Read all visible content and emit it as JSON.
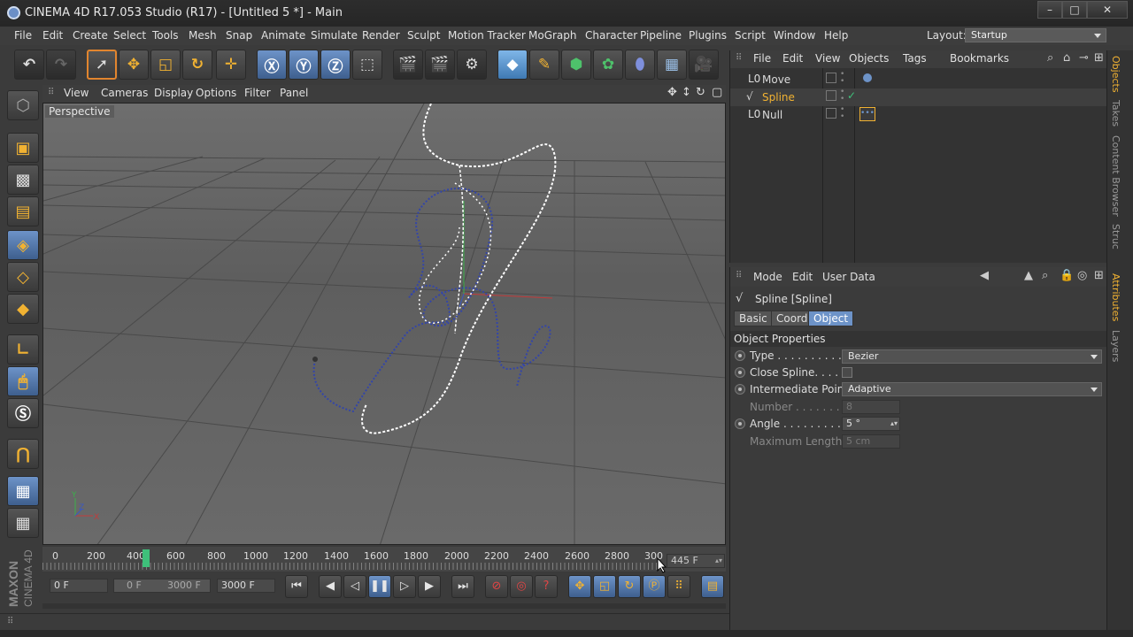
{
  "window": {
    "title": "CINEMA 4D R17.053 Studio (R17) - [Untitled 5 *] - Main",
    "minimize": "–",
    "maximize": "□",
    "close": "✕"
  },
  "menubar": {
    "items": [
      "File",
      "Edit",
      "Create",
      "Select",
      "Tools",
      "Mesh",
      "Snap",
      "Animate",
      "Simulate",
      "Render",
      "Sculpt",
      "Motion Tracker",
      "MoGraph",
      "Character",
      "Pipeline",
      "Plugins",
      "Script",
      "Window",
      "Help"
    ],
    "layout_label": "Layout:",
    "layout_value": "Startup"
  },
  "viewport": {
    "menu": [
      "View",
      "Cameras",
      "Display",
      "Options",
      "Filter",
      "Panel"
    ],
    "camera_label": "Perspective",
    "axis_y": "Y",
    "axis_x": "X",
    "axis_z": "Z"
  },
  "timeline": {
    "ticks": [
      "0",
      "200",
      "400",
      "600",
      "800",
      "1000",
      "1200",
      "1400",
      "1600",
      "1800",
      "2000",
      "2200",
      "2400",
      "2600",
      "2800",
      "300"
    ],
    "current_frame_display": "445 F",
    "start_frame": "0 F",
    "range_min": "0 F",
    "range_max": "3000 F",
    "end_frame": "3000 F",
    "current_frame_marker": 445,
    "timeline_max": 3000
  },
  "object_manager": {
    "menu": [
      "File",
      "Edit",
      "View",
      "Objects",
      "Tags",
      "Bookmarks"
    ],
    "objects": [
      {
        "name": "Move",
        "selected": false,
        "color": "#dadada"
      },
      {
        "name": "Spline",
        "selected": true,
        "color": "#f1b232"
      },
      {
        "name": "Null",
        "selected": false,
        "color": "#dadada"
      }
    ]
  },
  "attribute_manager": {
    "menu": [
      "Mode",
      "Edit",
      "User Data"
    ],
    "object_title": "Spline [Spline]",
    "tabs": [
      "Basic",
      "Coord.",
      "Object"
    ],
    "active_tab": "Object",
    "section": "Object Properties",
    "props": {
      "type_label": "Type . . . . . . . . . . . .",
      "type_value": "Bezier",
      "close_label": "Close Spline. . . . . .",
      "intermediate_label": "Intermediate Points",
      "intermediate_value": "Adaptive",
      "number_label": "Number . . . . . . . . .",
      "number_value": "8",
      "angle_label": "Angle . . . . . . . . . . .",
      "angle_value": "5 °",
      "maxlen_label": "Maximum Length  .",
      "maxlen_value": "5 cm"
    }
  },
  "right_tabs": [
    "Objects",
    "Takes",
    "Content Browser",
    "Struc",
    "Attributes",
    "Layers"
  ],
  "logo": {
    "line1": "MAXON",
    "line2": "CINEMA 4D"
  },
  "colors": {
    "accent": "#f1b232",
    "selection_blue": "#6d93c8",
    "background": "#3b3b3b"
  }
}
